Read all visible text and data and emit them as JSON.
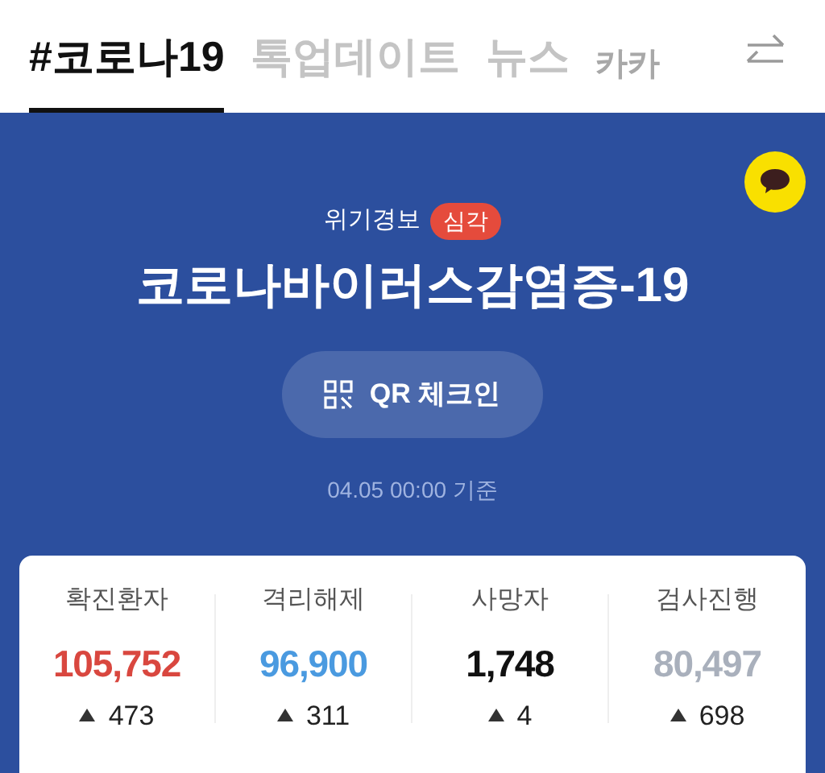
{
  "tabs": [
    {
      "label": "#코로나19",
      "selected": true
    },
    {
      "label": "톡업데이트",
      "selected": false
    },
    {
      "label": "뉴스",
      "selected": false
    },
    {
      "label": "카카",
      "selected": false
    }
  ],
  "banner": {
    "alert_label": "위기경보",
    "alert_level": "심각",
    "title": "코로나바이러스감염증-19",
    "qr_button": "QR 체크인",
    "timestamp": "04.05 00:00 기준"
  },
  "stats": [
    {
      "label": "확진환자",
      "value": "105,752",
      "color": "#d9473f",
      "delta": "473"
    },
    {
      "label": "격리해제",
      "value": "96,900",
      "color": "#4a9ae0",
      "delta": "311"
    },
    {
      "label": "사망자",
      "value": "1,748",
      "color": "#111111",
      "delta": "4"
    },
    {
      "label": "검사진행",
      "value": "80,497",
      "color": "#a9b0bc",
      "delta": "698"
    }
  ]
}
